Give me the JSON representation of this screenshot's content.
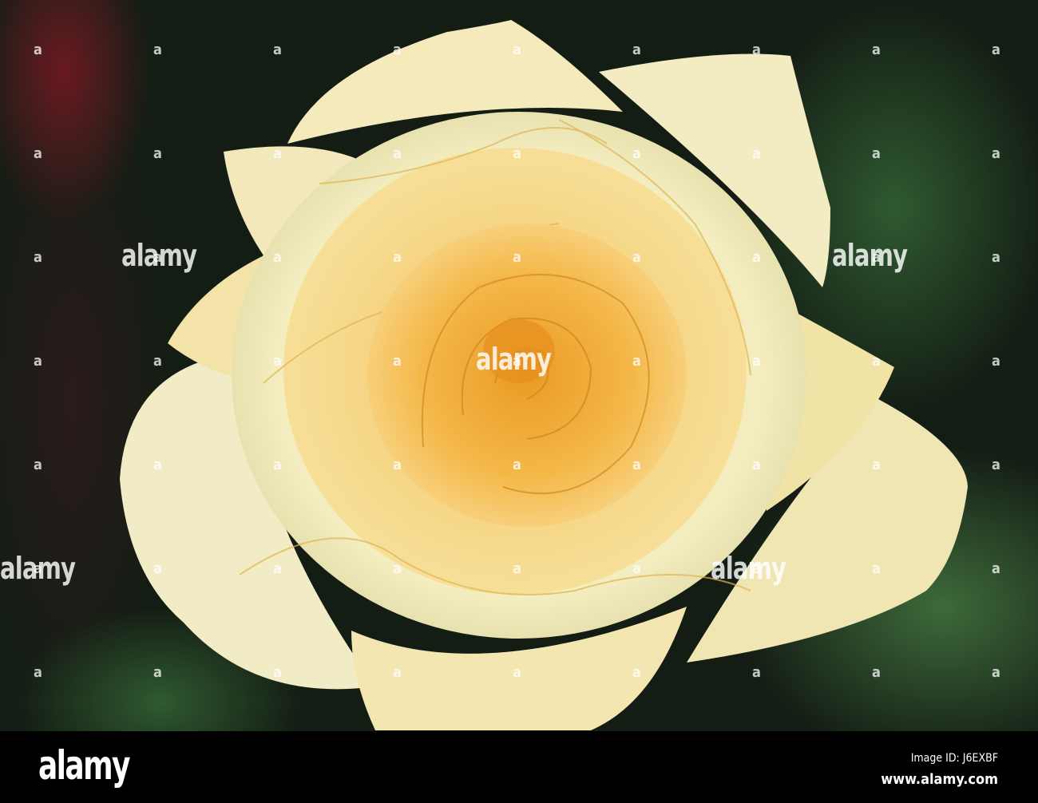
{
  "photo": {
    "subject": "yellow-rose",
    "colors": {
      "petal_outer": "#f3eab8",
      "petal_mid": "#f6d67a",
      "center": "#f0a630",
      "foliage": "#2f5a30",
      "bud": "#6b1a22"
    }
  },
  "watermark": {
    "text": "alamy",
    "mark": "a"
  },
  "footer": {
    "logo": "alamy",
    "image_id": "Image ID: J6EXBF",
    "website": "www.alamy.com"
  }
}
